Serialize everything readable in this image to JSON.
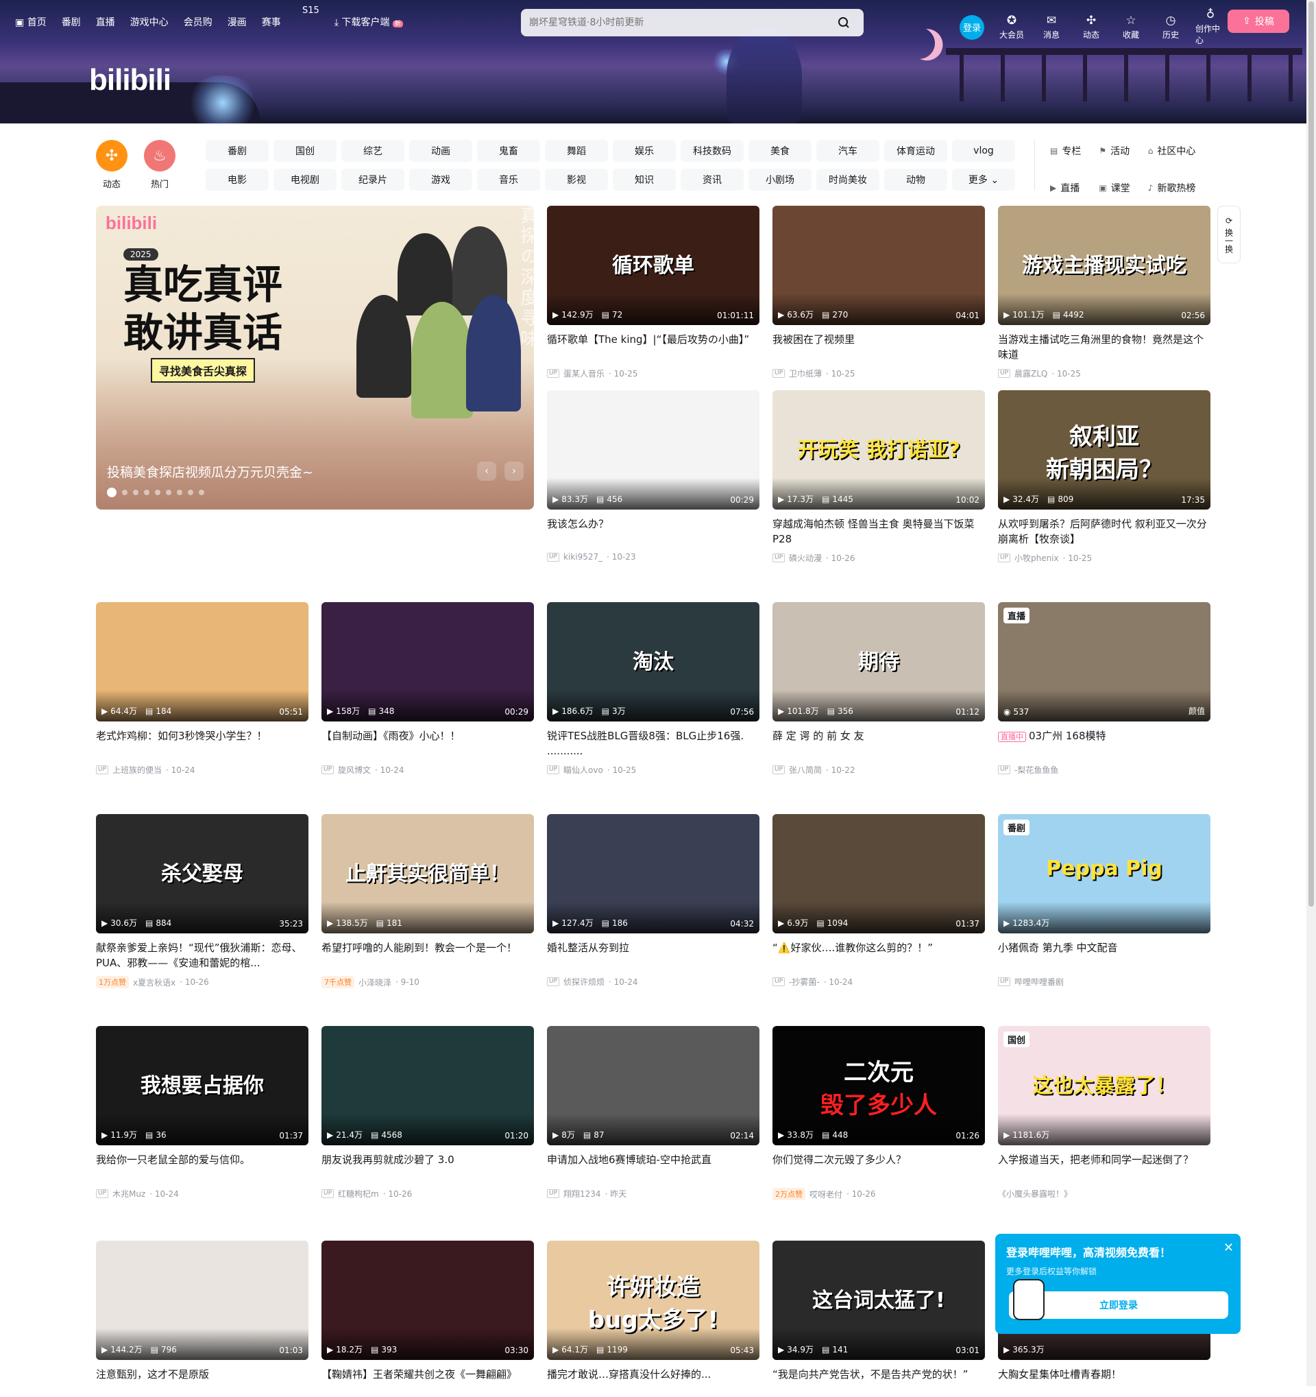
{
  "topnav": {
    "items": [
      "首页",
      "番剧",
      "直播",
      "游戏中心",
      "会员购",
      "漫画",
      "赛事"
    ],
    "s15": "S15",
    "download": "下载客户端",
    "download_badge": "新"
  },
  "search": {
    "placeholder": "崩坏星穹铁道·8小时前更新"
  },
  "rightnav": {
    "login": "登录",
    "items": [
      "大会员",
      "消息",
      "动态",
      "收藏",
      "历史",
      "创作中心"
    ],
    "upload": "投稿"
  },
  "brand_logo": "bilibili",
  "channels": {
    "circles": [
      {
        "label": "动态",
        "color": "#ff9212"
      },
      {
        "label": "热门",
        "color": "#f07775"
      }
    ],
    "grid": [
      "番剧",
      "国创",
      "综艺",
      "动画",
      "鬼畜",
      "舞蹈",
      "娱乐",
      "科技数码",
      "美食",
      "汽车",
      "体育运动",
      "vlog",
      "电影",
      "电视剧",
      "纪录片",
      "游戏",
      "音乐",
      "影视",
      "知识",
      "资讯",
      "小剧场",
      "时尚美妆",
      "动物",
      "更多"
    ],
    "right": [
      "专栏",
      "活动",
      "社区中心",
      "直播",
      "课堂",
      "新歌热榜"
    ]
  },
  "carousel": {
    "caption": "投稿美食探店视频瓜分万元贝壳金~",
    "poster_title": "真吃真评\n敢讲真话",
    "poster_sub": "寻找美食舌尖真探",
    "poster_logo": "bilibili",
    "poster_year": "2025",
    "poster_vertical": "真探の深度寻味",
    "slides": 9,
    "active": 0
  },
  "refresh": "换一换",
  "videos": [
    {
      "title": "循环歌单【The king】|“【最后攻势の小曲】”",
      "author": "蛋某人音乐",
      "date": "10-25",
      "views": "142.9万",
      "danmaku": "72",
      "duration": "01:01:11",
      "big": "循环歌单",
      "bg": "#3b1f16"
    },
    {
      "title": "我被困在了视频里",
      "author": "卫巾纸薄",
      "date": "10-25",
      "views": "63.6万",
      "danmaku": "270",
      "duration": "04:01",
      "big": "",
      "bg": "#6b4632"
    },
    {
      "title": "当游戏主播试吃三角洲里的食物！竟然是这个味道",
      "author": "晨露ZLQ",
      "date": "10-25",
      "views": "101.1万",
      "danmaku": "4492",
      "duration": "02:56",
      "big": "游戏主播现实试吃",
      "bg": "#b6a27f"
    },
    {
      "title": "我该怎么办？",
      "author": "kiki9527_",
      "date": "10-23",
      "views": "83.3万",
      "danmaku": "456",
      "duration": "00:29",
      "big": "",
      "bg": "#f4f4f4"
    },
    {
      "title": "穿越成海帕杰顿 怪兽当主食 奥特曼当下饭菜P28",
      "author": "磷火动漫",
      "date": "10-26",
      "views": "17.3万",
      "danmaku": "1445",
      "duration": "10:02",
      "big": "开玩笑 我打诺亚?",
      "bg": "#e8e3d6"
    },
    {
      "title": "从欢呼到屠杀？后阿萨德时代 叙利亚又一次分崩离析【牧奈谈】",
      "author": "小牧phenix",
      "date": "10-25",
      "views": "32.4万",
      "danmaku": "809",
      "duration": "17:35",
      "big": "叙利亚\n新朝困局？",
      "bg": "#6b5a3d"
    },
    {
      "title": "老式炸鸡柳：如何3秒馋哭小学生？！",
      "author": "上班族的便当",
      "date": "10-24",
      "views": "64.4万",
      "danmaku": "184",
      "duration": "05:51",
      "big": "",
      "bg": "#e8b676"
    },
    {
      "title": "【自制动画】《雨夜》小心！！",
      "author": "旋风博文",
      "date": "10-24",
      "views": "158万",
      "danmaku": "348",
      "duration": "00:29",
      "big": "",
      "bg": "#3a2042"
    },
    {
      "title": "锐评TES战胜BLG晋级8强：BLG止步16强. ...........",
      "author": "瞄仙人ovo",
      "date": "10-25",
      "views": "186.6万",
      "danmaku": "3万",
      "duration": "07:56",
      "big": "淘汰",
      "bg": "#2b3a3e"
    },
    {
      "title": "薛 定 谔 的 前 女 友",
      "author": "张八简简",
      "date": "10-22",
      "views": "101.8万",
      "danmaku": "356",
      "duration": "01:12",
      "big": "期待",
      "bg": "#c9bfb2"
    },
    {
      "title": "03广州 168模特",
      "author": "-梨花鱼鱼鱼",
      "date": "",
      "views": "537",
      "danmaku": "",
      "duration": "颜值",
      "big": "",
      "bg": "#8a7a68",
      "badge": "直播",
      "live": "直播中"
    },
    {
      "title": "献祭亲爹爱上亲妈！“现代”俄狄浦斯：恋母、PUA、邪教——《安迪和蕾妮的棺...",
      "author": "x夏言秋语x",
      "date": "10-26",
      "views": "30.6万",
      "danmaku": "884",
      "duration": "35:23",
      "big": "杀父娶母",
      "bg": "#2a2a2a",
      "tag": "1万点赞"
    },
    {
      "title": "希望打呼噜的人能刷到！教会一个是一个！",
      "author": "小泽晓泽",
      "date": "9-10",
      "views": "138.5万",
      "danmaku": "181",
      "duration": "",
      "big": "止鼾其实很简单！",
      "bg": "#d9c2a6",
      "tag": "7千点赞"
    },
    {
      "title": "婚礼整活从夯到拉",
      "author": "侦探许烦烦",
      "date": "10-24",
      "views": "127.4万",
      "danmaku": "186",
      "duration": "04:32",
      "big": "",
      "bg": "#3a3f54"
    },
    {
      "title": "“⚠️好家伙….谁教你这么剪的？！”",
      "author": "-抄雾菌-",
      "date": "10-24",
      "views": "6.9万",
      "danmaku": "1094",
      "duration": "01:37",
      "big": "",
      "bg": "#5a4a3a"
    },
    {
      "title": "小猪佩奇 第九季 中文配音",
      "author": "哔哩哔哩番剧",
      "date": "",
      "views": "1283.4万",
      "danmaku": "",
      "duration": "",
      "big": "Peppa Pig",
      "bg": "#9fd3f0",
      "badge": "番剧"
    },
    {
      "title": "我给你一只老鼠全部的爱与信仰。",
      "author": "木兆Muz",
      "date": "10-24",
      "views": "11.9万",
      "danmaku": "36",
      "duration": "01:37",
      "big": "我想要占据你",
      "bg": "#1a1a1a"
    },
    {
      "title": "朋友说我再剪就成沙碧了 3.0",
      "author": "红糖枸杞m",
      "date": "10-26",
      "views": "21.4万",
      "danmaku": "4568",
      "duration": "01:20",
      "big": "",
      "bg": "#1f3a3a"
    },
    {
      "title": "申请加入战地6赛博琥珀-空中抢武直",
      "author": "翔翔1234",
      "date": "昨天",
      "views": "8万",
      "danmaku": "87",
      "duration": "02:14",
      "big": "",
      "bg": "#5a5a5a"
    },
    {
      "title": "你们觉得二次元毁了多少人？",
      "author": "哎呀老付",
      "date": "10-26",
      "views": "33.8万",
      "danmaku": "448",
      "duration": "01:26",
      "big": "二次元\n毁了多少人",
      "bg": "#050505",
      "tag": "2万点赞"
    },
    {
      "title": "入学报道当天，把老师和同学一起迷倒了？",
      "author": "《小魔头暴露啦！》",
      "date": "",
      "views": "1181.6万",
      "danmaku": "",
      "duration": "",
      "big": "这也太暴露了！",
      "bg": "#f5e0e6",
      "badge": "国创"
    },
    {
      "title": "注意甄别，这才不是原版",
      "author": "",
      "date": "",
      "views": "144.2万",
      "danmaku": "796",
      "duration": "01:03",
      "big": "",
      "bg": "#e9e4df"
    },
    {
      "title": "【鞠婧祎】王者荣耀共创之夜《一舞翩翩》",
      "author": "",
      "date": "",
      "views": "18.2万",
      "danmaku": "393",
      "duration": "03:30",
      "big": "",
      "bg": "#3a1a1e"
    },
    {
      "title": "播完才敢说…穿搭真没什么好捧的...",
      "author": "",
      "date": "",
      "views": "64.1万",
      "danmaku": "1199",
      "duration": "05:43",
      "big": "许妍妆造\nbug太多了!",
      "bg": "#e8c9a0"
    },
    {
      "title": "“我是向共产党告状，不是告共产党的状！”",
      "author": "",
      "date": "",
      "views": "34.9万",
      "danmaku": "141",
      "duration": "03:01",
      "big": "这台词太猛了!",
      "bg": "#2a2a2a"
    },
    {
      "title": "大胸女星集体吐槽青春期！",
      "author": "",
      "date": "",
      "views": "365.3万",
      "danmaku": "",
      "duration": "",
      "big": "",
      "bg": "#3a2a2a"
    }
  ],
  "popup": {
    "title": "登录哔哩哔哩，高清视频免费看！",
    "subtitle": "更多登录后权益等你解锁",
    "button": "立即登录"
  }
}
